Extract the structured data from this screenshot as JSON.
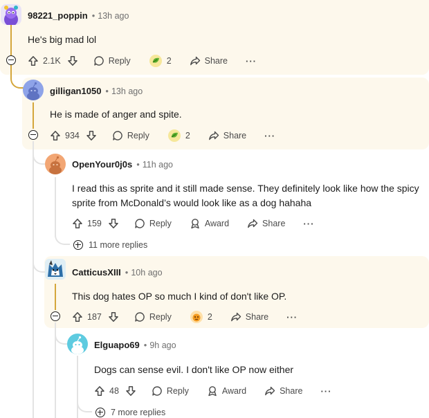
{
  "colors": {
    "highlight_bg": "#fdf8ec",
    "op_thread_line": "#d4a63b",
    "thread_line": "#e3e3e3",
    "avatar_gilligan": "#8ea3e8",
    "avatar_openyour": "#f2a674",
    "avatar_elguapo": "#5ecbe0"
  },
  "comments": [
    {
      "id": "c1",
      "username": "98221_poppin",
      "time": "13h ago",
      "body": "He's big mad lol",
      "votes": "2.1K",
      "reply_label": "Reply",
      "award_count": "2",
      "award_icon": "green-award-icon",
      "share_label": "Share",
      "more_label": "···",
      "avatar_icon": "purple-character-avatar"
    },
    {
      "id": "c2",
      "username": "gilligan1050",
      "time": "13h ago",
      "body": "He is made of anger and spite.",
      "votes": "934",
      "reply_label": "Reply",
      "award_count": "2",
      "award_icon": "green-award-icon",
      "share_label": "Share",
      "more_label": "···",
      "avatar_icon": "snoo-avatar"
    },
    {
      "id": "c3",
      "username": "OpenYour0j0s",
      "time": "11h ago",
      "body_line1": "I read this as sprite and it still made sense. They definitely look like how the spicy",
      "body_line2": "sprite from McDonald’s would look like as a dog hahaha",
      "votes": "159",
      "reply_label": "Reply",
      "award_label": "Award",
      "share_label": "Share",
      "more_label": "···",
      "more_replies": "11 more replies",
      "avatar_icon": "snoo-avatar"
    },
    {
      "id": "c4",
      "username": "CatticusXIII",
      "time": "10h ago",
      "body": "This dog hates OP so much I kind of don't like OP.",
      "votes": "187",
      "reply_label": "Reply",
      "award_count": "2",
      "award_icon": "orange-award-icon",
      "share_label": "Share",
      "more_label": "···",
      "avatar_icon": "wolf-avatar"
    },
    {
      "id": "c5",
      "username": "Elguapo69",
      "time": "9h ago",
      "body": "Dogs can sense evil. I don't like OP now either",
      "votes": "48",
      "reply_label": "Reply",
      "award_label": "Award",
      "share_label": "Share",
      "more_label": "···",
      "more_replies": "7 more replies",
      "avatar_icon": "snoo-avatar"
    }
  ]
}
